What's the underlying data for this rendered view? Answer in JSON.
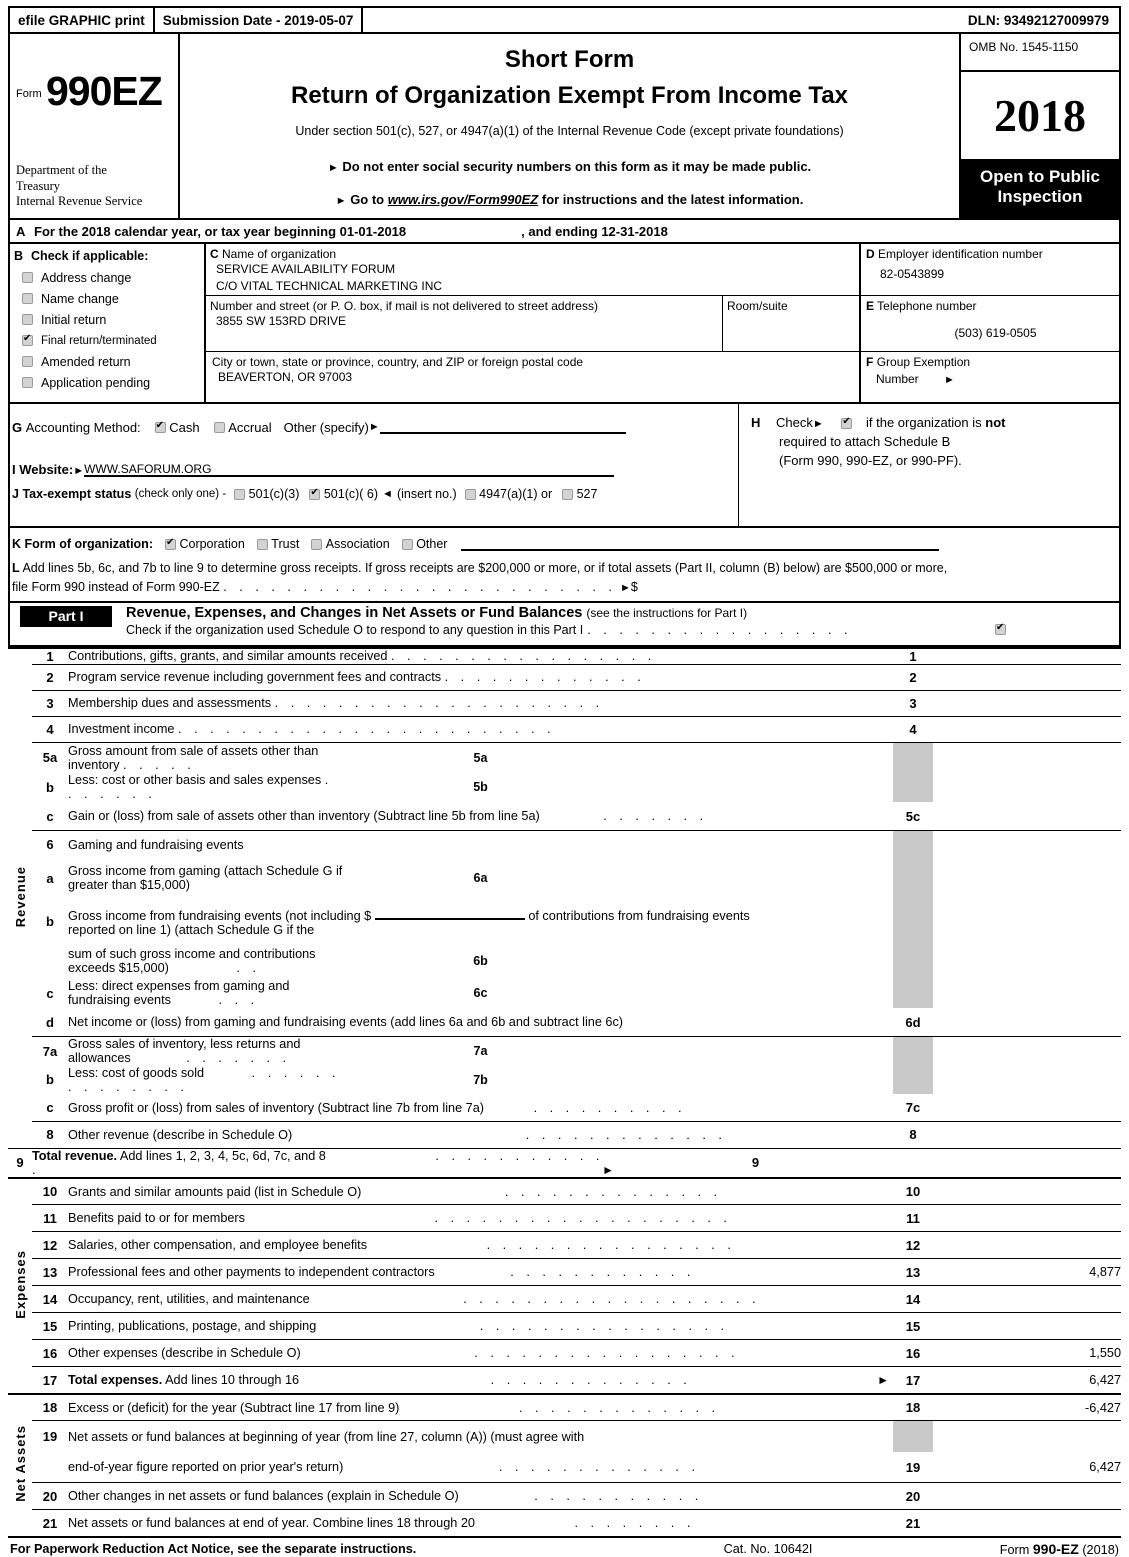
{
  "efile": {
    "graphic_print": "efile GRAPHIC print",
    "submission_date": "Submission Date - 2019-05-07",
    "dln": "DLN: 93492127009979"
  },
  "masthead": {
    "form_label": "Form",
    "form_number": "990EZ",
    "department": "Department of the\nTreasury\nInternal Revenue Service",
    "dept_line1": "Department of the",
    "dept_line2": "Treasury",
    "dept_line3": "Internal Revenue Service",
    "title_short": "Short Form",
    "title_main": "Return of Organization Exempt From Income Tax",
    "subtitle": "Under section 501(c), 527, or 4947(a)(1) of the Internal Revenue Code (except private foundations)",
    "bullet1": "Do not enter social security numbers on this form as it may be made public.",
    "bullet2_pre": "Go to ",
    "bullet2_link": "www.irs.gov/Form990EZ",
    "bullet2_post": " for instructions and the latest information.",
    "omb": "OMB No. 1545-1150",
    "tax_year": "2018",
    "open_to_public": "Open to Public",
    "inspection": "Inspection"
  },
  "lineA": {
    "letter": "A",
    "text_pre": "For the 2018 calendar year, or tax year beginning",
    "begin_date": "01-01-2018",
    "text_mid": ", and ending",
    "end_date": "12-31-2018"
  },
  "sectionB": {
    "letter": "B",
    "heading": "Check if applicable:",
    "options": [
      {
        "label": "Address change",
        "checked": false
      },
      {
        "label": "Name change",
        "checked": false
      },
      {
        "label": "Initial return",
        "checked": false
      },
      {
        "label": "Final return/terminated",
        "checked": true
      },
      {
        "label": "Amended return",
        "checked": false
      },
      {
        "label": "Application pending",
        "checked": false
      }
    ]
  },
  "sectionC": {
    "letter": "C",
    "name_label": "Name of organization",
    "org_name_line1": "SERVICE AVAILABILITY FORUM",
    "org_name_line2": "C/O VITAL TECHNICAL MARKETING INC",
    "street_label": "Number and street (or P. O. box, if mail is not delivered to street address)",
    "street_value": "3855 SW 153RD DRIVE",
    "room_label": "Room/suite",
    "room_value": "",
    "city_label": "City or town, state or province, country, and ZIP or foreign postal code",
    "city_value": "BEAVERTON, OR   97003"
  },
  "sectionD": {
    "letter": "D",
    "label": "Employer identification number",
    "value": "82-0543899"
  },
  "sectionE": {
    "letter": "E",
    "label": "Telephone number",
    "value": "(503) 619-0505"
  },
  "sectionF": {
    "letter": "F",
    "label": "Group Exemption",
    "label2": "Number"
  },
  "sectionG": {
    "letter": "G",
    "label": "Accounting Method:",
    "cash": "Cash",
    "cash_checked": true,
    "accrual": "Accrual",
    "accrual_checked": false,
    "other": "Other (specify)",
    "other_value": ""
  },
  "sectionH": {
    "letter": "H",
    "check_label": "Check",
    "checked": true,
    "text1_pre": "if the organization is ",
    "text1_bold": "not",
    "text2": "required to attach Schedule B",
    "text3": "(Form 990, 990-EZ, or 990-PF)."
  },
  "sectionI": {
    "letter": "I",
    "label": "Website:",
    "value": "WWW.SAFORUM.ORG"
  },
  "sectionJ": {
    "letter": "J",
    "label": "Tax-exempt status",
    "note": "(check only one) -",
    "options": [
      {
        "label": "501(c)(3)",
        "checked": false
      },
      {
        "label": "501(c)( 6)",
        "checked": true
      },
      {
        "label": "4947(a)(1) or",
        "checked": false
      },
      {
        "label": "527",
        "checked": false
      }
    ],
    "insert_no": "(insert no.)"
  },
  "sectionK": {
    "letter": "K",
    "label": "Form of organization:",
    "options": [
      {
        "label": "Corporation",
        "checked": true
      },
      {
        "label": "Trust",
        "checked": false
      },
      {
        "label": "Association",
        "checked": false
      },
      {
        "label": "Other",
        "checked": false
      }
    ],
    "other_value": ""
  },
  "sectionL": {
    "letter": "L",
    "line1": "Add lines 5b, 6c, and 7b to line 9 to determine gross receipts. If gross receipts are $200,000 or more, or if total assets (Part II, column (B) below) are $500,000 or more,",
    "line2": "file Form 990 instead of Form 990-EZ",
    "dots": ". . . . . . . . . . . . . . . . . . . . . . . . .",
    "arrow_dollar": "$",
    "value": ""
  },
  "partI": {
    "badge": "Part I",
    "title": "Revenue, Expenses, and Changes in Net Assets or Fund Balances",
    "title_note": "(see the instructions for Part I)",
    "schedule_o_text": "Check if the organization used Schedule O to respond to any question in this Part I",
    "schedule_o_dots": ". . . . . . . . . . . . . . . . .",
    "schedule_o_checked": true
  },
  "categories": {
    "revenue": "Revenue",
    "expenses": "Expenses",
    "net_assets": "Net Assets"
  },
  "rows": {
    "r1": {
      "no": "1",
      "desc": "Contributions, gifts, grants, and similar amounts received",
      "dots": ". . . . . . . . . . . . . . . . .",
      "code": "1",
      "amount": ""
    },
    "r2": {
      "no": "2",
      "desc": "Program service revenue including government fees and contracts",
      "dots": ". . . . . . . . . . . . .",
      "code": "2",
      "amount": ""
    },
    "r3": {
      "no": "3",
      "desc": "Membership dues and assessments",
      "dots": ". . . . . . . . . . . . . . . . . . . . .",
      "code": "3",
      "amount": ""
    },
    "r4": {
      "no": "4",
      "desc": "Investment income",
      "dots": ". . . . . . . . . . . . . . . . . . . . . . . .",
      "code": "4",
      "amount": ""
    },
    "r5a": {
      "no": "5a",
      "desc": "Gross amount from sale of assets other than inventory",
      "dots": ". . . . .",
      "subno": "5a",
      "subval": ""
    },
    "r5b": {
      "no": "b",
      "desc": "Less: cost or other basis and sales expenses",
      "dots": ". . . . . . .",
      "subno": "5b",
      "subval": ""
    },
    "r5c": {
      "no": "c",
      "desc": "Gain or (loss) from sale of assets other than inventory (Subtract line 5b from line 5a)",
      "dots": ". . . . . . .",
      "code": "5c",
      "amount": ""
    },
    "r6": {
      "no": "6",
      "desc": "Gaming and fundraising events"
    },
    "r6a": {
      "no": "a",
      "desc": "Gross income from gaming (attach Schedule G if greater than $15,000)",
      "subno": "6a",
      "subval": ""
    },
    "r6b_l1_pre": "Gross income from fundraising events (not including $",
    "r6b_l1_post": "of contributions from fundraising events",
    "r6b_l2": "reported on line 1) (attach Schedule G if the",
    "r6b": {
      "no": "b",
      "desc": "sum of such gross income and contributions exceeds $15,000)",
      "dots": ". .",
      "subno": "6b",
      "subval": ""
    },
    "r6c": {
      "no": "c",
      "desc": "Less: direct expenses from gaming and fundraising events",
      "dots": ". . .",
      "subno": "6c",
      "subval": ""
    },
    "r6d": {
      "no": "d",
      "desc": "Net income or (loss) from gaming and fundraising events (add lines 6a and 6b and subtract line 6c)",
      "code": "6d",
      "amount": ""
    },
    "r7a": {
      "no": "7a",
      "desc": "Gross sales of inventory, less returns and allowances",
      "dots": ". . . . . . .",
      "subno": "7a",
      "subval": ""
    },
    "r7b": {
      "no": "b",
      "desc": "Less: cost of goods sold",
      "dots": ". . . . . . . . . . . . . .",
      "subno": "7b",
      "subval": ""
    },
    "r7c": {
      "no": "c",
      "desc": "Gross profit or (loss) from sales of inventory (Subtract line 7b from line 7a)",
      "dots": ". . . . . . . . . .",
      "code": "7c",
      "amount": ""
    },
    "r8": {
      "no": "8",
      "desc": "Other revenue (describe in Schedule O)",
      "dots": ". . . . . . . . . . . . .",
      "code": "8",
      "amount": ""
    },
    "r9": {
      "no": "9",
      "desc_bold": "Total revenue.",
      "desc": " Add lines 1, 2, 3, 4, 5c, 6d, 7c, and 8",
      "dots": ". . . . . . . . . . . .",
      "code": "9",
      "amount": ""
    },
    "r10": {
      "no": "10",
      "desc": "Grants and similar amounts paid (list in Schedule O)",
      "dots": ". . . . . . . . . . . . . .",
      "code": "10",
      "amount": ""
    },
    "r11": {
      "no": "11",
      "desc": "Benefits paid to or for members",
      "dots": ". . . . . . . . . . . . . . . . . . .",
      "code": "11",
      "amount": ""
    },
    "r12": {
      "no": "12",
      "desc": "Salaries, other compensation, and employee benefits",
      "dots": ". . . . . . . . . . . . . . . .",
      "code": "12",
      "amount": ""
    },
    "r13": {
      "no": "13",
      "desc": "Professional fees and other payments to independent contractors",
      "dots": ". . . . . . . . . . . .",
      "code": "13",
      "amount": "4,877"
    },
    "r14": {
      "no": "14",
      "desc": "Occupancy, rent, utilities, and maintenance",
      "dots": ". . . . . . . . . . . . . . . . . . .",
      "code": "14",
      "amount": ""
    },
    "r15": {
      "no": "15",
      "desc": "Printing, publications, postage, and shipping",
      "dots": ". . . . . . . . . . . . . . . .",
      "code": "15",
      "amount": ""
    },
    "r16": {
      "no": "16",
      "desc": "Other expenses (describe in Schedule O)",
      "dots": ". . . . . . . . . . . . . . . . .",
      "code": "16",
      "amount": "1,550"
    },
    "r17": {
      "no": "17",
      "desc_bold": "Total expenses.",
      "desc": " Add lines 10 through 16",
      "dots": ". . . . . . . . . . . . .",
      "code": "17",
      "amount": "6,427"
    },
    "r18": {
      "no": "18",
      "desc": "Excess or (deficit) for the year (Subtract line 17 from line 9)",
      "dots": ". . . . . . . . . . . . .",
      "code": "18",
      "amount": "-6,427"
    },
    "r19_l1": {
      "no": "19",
      "desc": "Net assets or fund balances at beginning of year (from line 27, column (A)) (must agree with"
    },
    "r19": {
      "desc": "end-of-year figure reported on prior year's return)",
      "dots": ". . . . . . . . . . . . .",
      "code": "19",
      "amount": "6,427"
    },
    "r20": {
      "no": "20",
      "desc": "Other changes in net assets or fund balances (explain in Schedule O)",
      "dots": ". . . . . . . . . . .",
      "code": "20",
      "amount": ""
    },
    "r21": {
      "no": "21",
      "desc": "Net assets or fund balances at end of year. Combine lines 18 through 20",
      "dots": ". . . . . . . .",
      "code": "21",
      "amount": ""
    }
  },
  "footer": {
    "left": "For Paperwork Reduction Act Notice, see the separate instructions.",
    "center": "Cat. No. 10642I",
    "right_pre": "Form ",
    "right_bold": "990-EZ",
    "right_post": " (2018)"
  }
}
